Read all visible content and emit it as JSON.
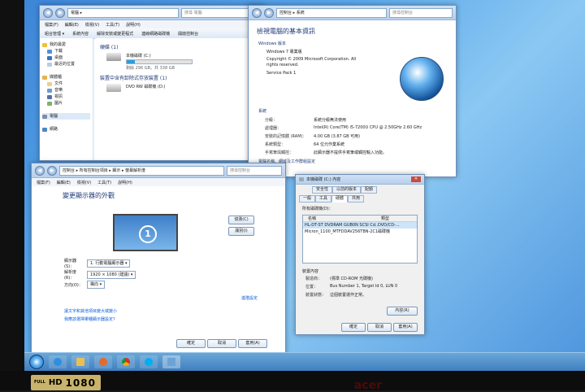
{
  "explorer": {
    "address": "電腦 ▸",
    "search": "搜尋 電腦",
    "menu": [
      "檔案(F)",
      "編輯(E)",
      "檢視(V)",
      "工具(T)",
      "說明(H)"
    ],
    "toolbar": [
      "組合管理 ▾",
      "系統內容",
      "解除安裝或變更程式",
      "連線網路磁碟機",
      "開啟控制台"
    ],
    "sidebar": [
      "我的最愛",
      "下載",
      "桌面",
      "最近的位置",
      "",
      "媒體櫃",
      "文件",
      "音樂",
      "視訊",
      "圖片",
      "",
      "電腦",
      "",
      "網路"
    ],
    "hdd_section": "硬碟 (1)",
    "hdd_name": "本機磁碟 (C:)",
    "hdd_free": "剩餘 296 GB，共 338 GB",
    "hdd_used_fraction": 0.13,
    "removable_section": "裝置中含有卸除式存放裝置 (1)",
    "dvd_name": "DVD RW 磁碟機 (D:)"
  },
  "system": {
    "address": "控制台 ▸ 系統",
    "search": "搜尋控制台",
    "heading": "檢視電腦的基本資訊",
    "edition_label": "Windows 版本",
    "edition": "Windows 7 專業版",
    "copyright": "Copyright © 2009 Microsoft Corporation. All rights reserved.",
    "service_pack": "Service Pack 1",
    "system_label": "系統",
    "rows": [
      {
        "k": "分級：",
        "v": "系統分級無法使用"
      },
      {
        "k": "處理器：",
        "v": "Intel(R) Core(TM) i5-7200U CPU @ 2.50GHz   2.60 GHz"
      },
      {
        "k": "安裝的記憶體 (RAM)：",
        "v": "4.00 GB (3.87 GB 可用)"
      },
      {
        "k": "系統類型：",
        "v": "64 位元作業系統"
      },
      {
        "k": "手寫筆與觸控：",
        "v": "此顯示器不提供手寫筆或觸控輸入功能。"
      }
    ],
    "workgroup": "電腦名稱、網域及工作群組設定"
  },
  "display": {
    "address": "控制台 ▸ 所有控制台項目 ▸ 顯示 ▸ 螢幕解析度",
    "search": "搜尋控制台",
    "menu": [
      "檔案(F)",
      "編輯(E)",
      "檢視(V)",
      "工具(T)",
      "說明(H)"
    ],
    "heading": "變更顯示器的外觀",
    "monitor_number": "1",
    "detect": "偵測(C)",
    "identify": "識別(I)",
    "display_label": "顯示器(S)：",
    "display_value": "1. 行動電腦顯示器 ▾",
    "res_label": "解析度(R)：",
    "res_value": "1920 × 1080 (建議) ▾",
    "orient_label": "方向(O)：",
    "orient_value": "橫向 ▾",
    "advanced": "進階設定",
    "link1": "讓文字和其他項目變大或變小",
    "link2": "我應該選擇哪種顯示器設定?",
    "ok": "確定",
    "cancel": "取消",
    "apply": "套用(A)"
  },
  "props": {
    "title": "本機磁碟 (C:) 內容",
    "tabs_top": [
      "安全性",
      "以前的版本",
      "配額"
    ],
    "tabs_bottom": [
      "一般",
      "工具",
      "硬體",
      "共用"
    ],
    "list_label": "所有磁碟機(D)：",
    "col_name": "名稱",
    "col_type": "類型",
    "devices": [
      {
        "name": "HL-DT-ST DVDRAM GUB0N SCSI Cd...",
        "type": "DVD/CD-..."
      },
      {
        "name": "Micron_1100_MTFDDAV256TBN-2C1...",
        "type": "磁碟機"
      }
    ],
    "group_label": "裝置內容",
    "details": [
      {
        "k": "製造商：",
        "v": "(標準 CD-ROM 光碟機)"
      },
      {
        "k": "位置：",
        "v": "Bus Number 1, Target Id 0, LUN 0"
      },
      {
        "k": "裝置狀態：",
        "v": "這個裝置運作正常。"
      }
    ],
    "properties_btn": "內容(R)",
    "ok": "確定",
    "cancel": "取消",
    "apply": "套用(A)"
  },
  "badge": {
    "full": "FULL",
    "hd": "HD",
    "res": "1080"
  },
  "brand": "acer"
}
